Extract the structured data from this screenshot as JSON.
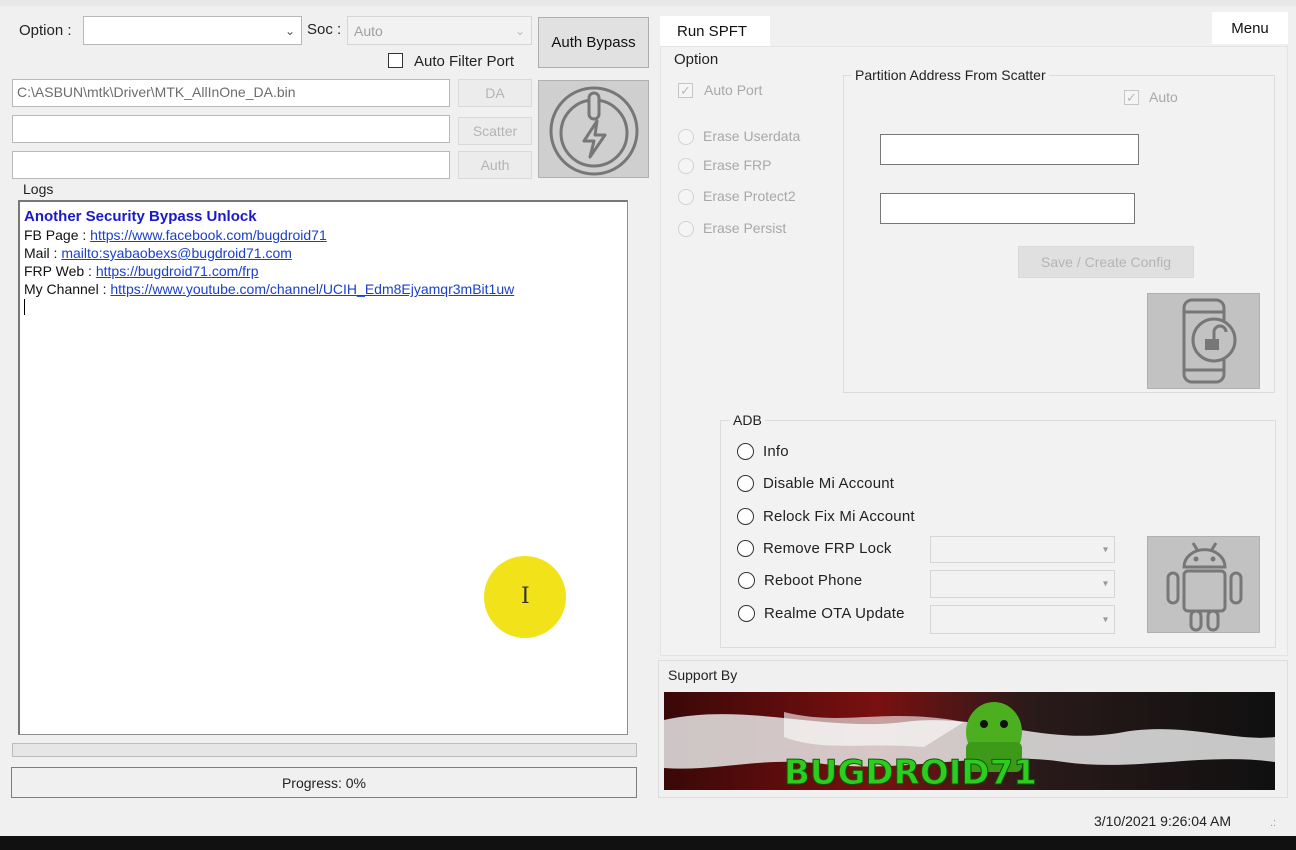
{
  "left": {
    "option_label": "Option :",
    "option_value": "",
    "soc_label": "Soc :",
    "soc_value": "Auto",
    "auth_bypass_label": "Auth Bypass",
    "auto_filter_port_label": "Auto Filter Port",
    "da_path": "C:\\ASBUN\\mtk\\Driver\\MTK_AllInOne_DA.bin",
    "scatter_path": "",
    "auth_path": "",
    "da_button": "DA",
    "scatter_button": "Scatter",
    "auth_button": "Auth",
    "logs_label": "Logs",
    "logs": {
      "title": "Another Security Bypass Unlock",
      "fb_label": "FB Page   : ",
      "fb_link": "https://www.facebook.com/bugdroid71",
      "mail_label": "Mail : ",
      "mail_link": "mailto:syabaobexs@bugdroid71.com",
      "frp_label": "FRP Web : ",
      "frp_link": "https://bugdroid71.com/frp",
      "channel_label": "My Channel  : ",
      "channel_link": "https://www.youtube.com/channel/UCIH_Edm8Ejyamqr3mBit1uw"
    },
    "progress_text": "Progress: 0%",
    "progress_value": 0
  },
  "tabs": {
    "run_spft": "Run SPFT",
    "menu": "Menu"
  },
  "option_group": {
    "label": "Option",
    "auto_port": "Auto Port",
    "erase_userdata": "Erase Userdata",
    "erase_frp": "Erase FRP",
    "erase_protect2": "Erase Protect2",
    "erase_persist": "Erase Persist"
  },
  "partition": {
    "label": "Partition Address From Scatter",
    "auto_label": "Auto",
    "address1": "",
    "address2": "",
    "save_config": "Save / Create Config"
  },
  "adb": {
    "label": "ADB",
    "info": "Info",
    "disable_mi": "Disable Mi Account",
    "relock_mi": "Relock Fix Mi Account",
    "remove_frp": "Remove FRP Lock",
    "reboot": "Reboot Phone",
    "realme_ota": "Realme OTA Update"
  },
  "support": {
    "label": "Support By",
    "banner_text": "BUGDROID71"
  },
  "status": {
    "datetime": "3/10/2021 9:26:04 AM"
  },
  "colors": {
    "link": "#1a3fcc",
    "log_title": "#1a1acc",
    "cursor_highlight": "#f2e21a",
    "banner_green": "#2ecc1f"
  }
}
